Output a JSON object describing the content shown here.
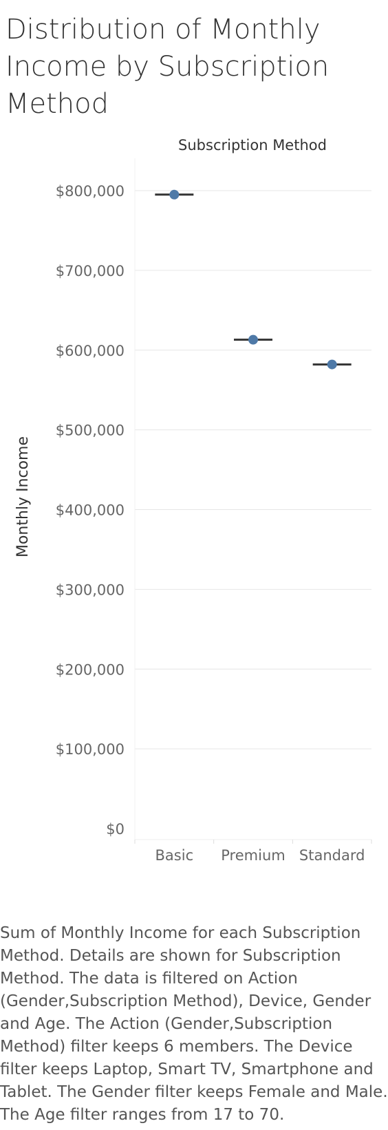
{
  "title": "Distribution of Monthly Income by Subscription Method",
  "caption": "Sum of Monthly Income for each Subscription Method.  Details are shown for Subscription Method. The data is filtered on Action (Gender,Subscription Method), Device, Gender and Age. The Action (Gender,Subscription Method) filter keeps 6 members. The Device filter keeps Laptop, Smart TV, Smartphone and Tablet. The Gender filter keeps Female and Male. The Age filter ranges from 17 to 70.",
  "colors": {
    "point": "#4e79a7",
    "whisker": "#333333",
    "grid": "#e6e6e6",
    "tick_text": "#666666"
  },
  "chart_data": {
    "type": "scatter",
    "title": "Distribution of Monthly Income by Subscription Method",
    "column_header": "Subscription Method",
    "xlabel": "",
    "ylabel": "Monthly Income",
    "categories": [
      "Basic",
      "Premium",
      "Standard"
    ],
    "values": [
      795000,
      613000,
      582000
    ],
    "ylim": [
      0,
      850000
    ],
    "yticks": [
      0,
      100000,
      200000,
      300000,
      400000,
      500000,
      600000,
      700000,
      800000
    ],
    "ytick_labels": [
      "$0",
      "$100,000",
      "$200,000",
      "$300,000",
      "$400,000",
      "$500,000",
      "$600,000",
      "$700,000",
      "$800,000"
    ],
    "grid": true,
    "legend": "none"
  }
}
